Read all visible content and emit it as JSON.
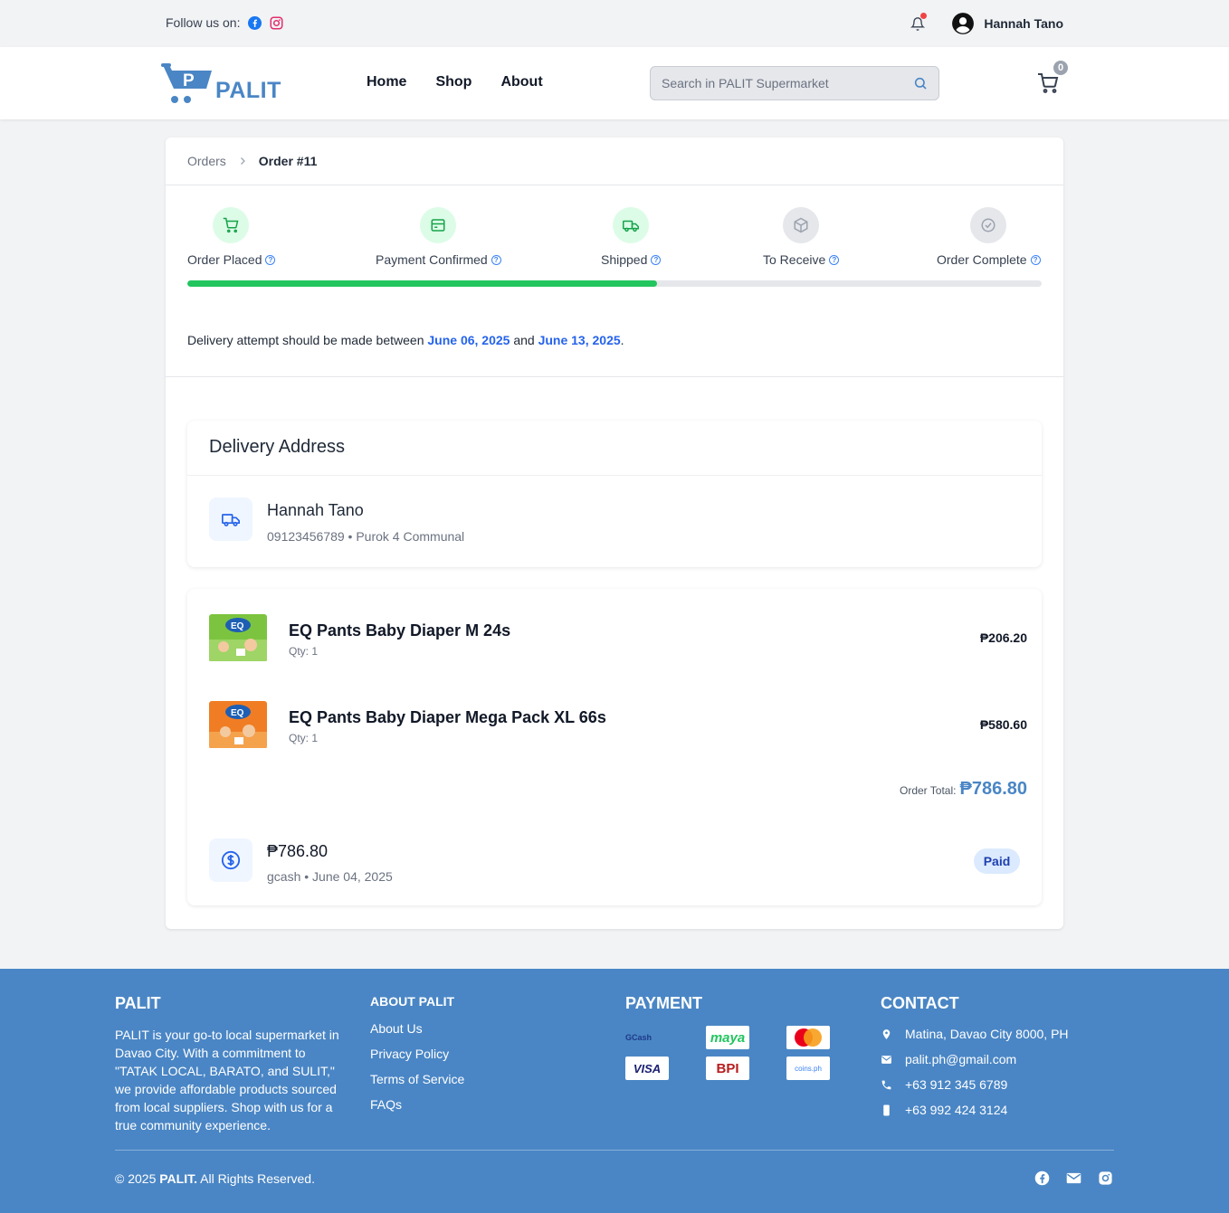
{
  "topbar": {
    "follow_label": "Follow us on:",
    "user_name": "Hannah Tano"
  },
  "header": {
    "logo_text": "PALIT",
    "logo_letter": "P",
    "nav": [
      "Home",
      "Shop",
      "About"
    ],
    "search_placeholder": "Search in PALIT Supermarket",
    "cart_count": "0"
  },
  "breadcrumb": {
    "parent": "Orders",
    "current": "Order #11"
  },
  "steps": [
    {
      "label": "Order Placed",
      "status": "done",
      "icon": "cart-icon"
    },
    {
      "label": "Payment Confirmed",
      "status": "done",
      "icon": "payment-icon"
    },
    {
      "label": "Shipped",
      "status": "done",
      "icon": "truck-icon"
    },
    {
      "label": "To Receive",
      "status": "pending",
      "icon": "box-icon"
    },
    {
      "label": "Order Complete",
      "status": "pending",
      "icon": "check-circle-icon"
    }
  ],
  "progress_fraction": 0.55,
  "delivery": {
    "prefix": "Delivery attempt should be made between",
    "start_date": "June 06, 2025",
    "connector": "and",
    "end_date": "June 13, 2025",
    "suffix": "."
  },
  "address": {
    "title": "Delivery Address",
    "name": "Hannah Tano",
    "phone": "09123456789",
    "location": "Purok 4 Communal"
  },
  "items": [
    {
      "name": "EQ Pants Baby Diaper M 24s",
      "qty": "Qty: 1",
      "price": "₱206.20"
    },
    {
      "name": "EQ Pants Baby Diaper Mega Pack XL 66s",
      "qty": "Qty: 1",
      "price": "₱580.60"
    }
  ],
  "order_total": {
    "label": "Order Total:",
    "value": "₱786.80"
  },
  "payment": {
    "amount": "₱786.80",
    "method": "gcash",
    "date": "June 04, 2025",
    "status": "Paid"
  },
  "footer": {
    "brand_title": "PALIT",
    "brand_desc": "PALIT is your go-to local supermarket in Davao City. With a commitment to \"TATAK LOCAL, BARATO, and SULIT,\" we provide affordable products sourced from local suppliers. Shop with us for a true community experience.",
    "about_title": "ABOUT PALIT",
    "about_links": [
      "About Us",
      "Privacy Policy",
      "Terms of Service",
      "FAQs"
    ],
    "payment_title": "PAYMENT",
    "payment_logos": [
      "GCash",
      "maya",
      "",
      "VISA",
      "BPI",
      "coins.ph"
    ],
    "contact_title": "CONTACT",
    "contact": {
      "address": "Matina, Davao City 8000, PH",
      "email": "palit.ph@gmail.com",
      "phone1": "+63 912 345 6789",
      "phone2": "+63 992 424 3124"
    },
    "copyright_prefix": "© 2025",
    "copyright_brand": "PALIT.",
    "copyright_suffix": "All Rights Reserved."
  },
  "colors": {
    "brand": "#4a86c5",
    "success": "#22c55e",
    "link": "#2563eb"
  }
}
